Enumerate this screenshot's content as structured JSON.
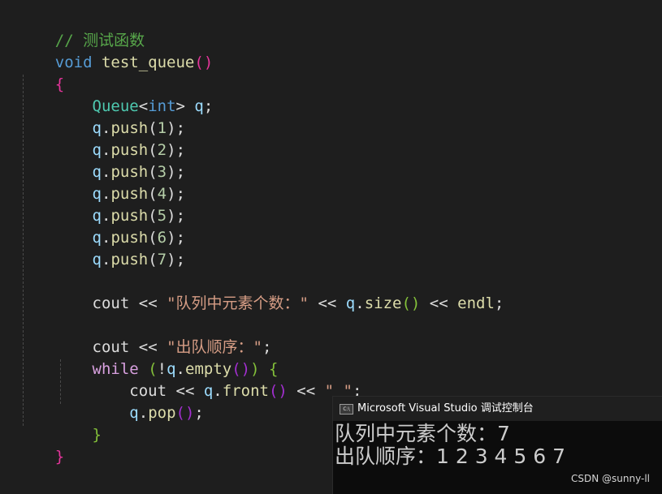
{
  "code": {
    "comment": "// 测试函数",
    "kw_void": "void",
    "fn_name": "test_queue",
    "paren_open": "(",
    "paren_close": ")",
    "brace_open": "{",
    "brace_close": "}",
    "type_queue": "Queue",
    "lt": "<",
    "kw_int": "int",
    "gt": ">",
    "var_q": "q",
    "semicolon": ";",
    "dot": ".",
    "fn_push": "push",
    "push_args": [
      "1",
      "2",
      "3",
      "4",
      "5",
      "6",
      "7"
    ],
    "cout": "cout",
    "op_shift": "<<",
    "str_size": "\"队列中元素个数：\"",
    "fn_size": "size",
    "empty_parens": "()",
    "endl": "endl",
    "str_order": "\"出队顺序：\"",
    "kw_while": "while",
    "not_op": "!",
    "fn_empty": "empty",
    "fn_front": "front",
    "str_space": "\" \"",
    "fn_pop": "pop"
  },
  "console": {
    "window_title": "Microsoft Visual Studio 调试控制台",
    "icon_text": "C:\\",
    "output_lines": [
      "队列中元素个数：7",
      "出队顺序：1 2 3 4 5 6 7"
    ]
  },
  "watermark": "CSDN @sunny-ll",
  "colors": {
    "background": "#1e1e1e",
    "comment": "#57a64a",
    "keyword": "#569cd6",
    "control_keyword": "#d8a0df",
    "function": "#dcdcaa",
    "type": "#4ec9b0",
    "variable": "#9cdcfe",
    "number": "#b5cea8",
    "string": "#d69d85",
    "bracket_level1": "#e4349a",
    "bracket_level2": "#84c13a",
    "bracket_level3": "#a32fd0",
    "console_background": "#0c0c0c"
  }
}
